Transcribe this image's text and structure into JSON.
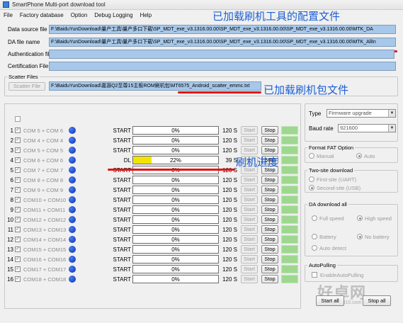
{
  "window": {
    "title": "SmartPhone Multi-port download tool"
  },
  "menu": [
    "File",
    "Factory database",
    "Option",
    "Debug Logging",
    "Help"
  ],
  "annotations": {
    "config_loaded": "已加载刷机工具的配置文件",
    "package_loaded": "已加载刷机包文件",
    "progress": "刷机进度"
  },
  "fields": {
    "data_source_label": "Data source file",
    "data_source_value": "F:\\BaiduYunDownload\\量产工具\\量产多口下载\\SP_MDT_exe_v3.1316.00.00\\SP_MDT_exe_v3.1316.00.00\\SP_MDT_exe_v3.1316.00.00\\MTK_DA",
    "da_file_label": "DA file name",
    "da_file_value": "F:\\BaiduYunDownload\\量产工具\\量产多口下载\\SP_MDT_exe_v3.1316.00.00\\SP_MDT_exe_v3.1316.00.00\\SP_MDT_exe_v3.1316.00.00\\MTK_AllIn",
    "auth_label": "Authentication file",
    "cert_label": "Certification File",
    "scatter_group": "Scatter Files",
    "scatter_button": "Scatter File",
    "scatter_value": "F:\\BaiduYunDownload\\嘉源Q2至尊15主板ROM刷机包\\MT6575_Android_scatter_emmc.txt"
  },
  "ports": [
    {
      "idx": "1",
      "ports": "COM 5 + COM 6",
      "status": "START",
      "percent": 0,
      "pct_text": "0%",
      "time": "120 S",
      "start": "Start",
      "stop": "Stop",
      "checked": "✓"
    },
    {
      "idx": "2",
      "ports": "COM 4 + COM 4",
      "status": "START",
      "percent": 0,
      "pct_text": "0%",
      "time": "120 S",
      "start": "Start",
      "stop": "Stop",
      "checked": "✓"
    },
    {
      "idx": "3",
      "ports": "COM 5 + COM 5",
      "status": "START",
      "percent": 0,
      "pct_text": "0%",
      "time": "120 S",
      "start": "Start",
      "stop": "Stop",
      "checked": "✓"
    },
    {
      "idx": "4",
      "ports": "COM 6 + COM 6",
      "status": "DL",
      "percent": 22,
      "pct_text": "22%",
      "time": "39 S",
      "start": "Start",
      "stop": "Stop",
      "checked": "✓"
    },
    {
      "idx": "5",
      "ports": "COM 7 + COM 7",
      "status": "START",
      "percent": 0,
      "pct_text": "0%",
      "time": "120 S",
      "start": "Start",
      "stop": "Stop",
      "checked": "✓"
    },
    {
      "idx": "6",
      "ports": "COM 8 + COM 8",
      "status": "START",
      "percent": 0,
      "pct_text": "0%",
      "time": "120 S",
      "start": "Start",
      "stop": "Stop",
      "checked": "✓"
    },
    {
      "idx": "7",
      "ports": "COM 9 + COM 9",
      "status": "START",
      "percent": 0,
      "pct_text": "0%",
      "time": "120 S",
      "start": "Start",
      "stop": "Stop",
      "checked": "✓"
    },
    {
      "idx": "8",
      "ports": "COM10 + COM10",
      "status": "START",
      "percent": 0,
      "pct_text": "0%",
      "time": "120 S",
      "start": "Start",
      "stop": "Stop",
      "checked": "✓"
    },
    {
      "idx": "9",
      "ports": "COM11 + COM11",
      "status": "START",
      "percent": 0,
      "pct_text": "0%",
      "time": "120 S",
      "start": "Start",
      "stop": "Stop",
      "checked": "✓"
    },
    {
      "idx": "10",
      "ports": "COM12 + COM12",
      "status": "START",
      "percent": 0,
      "pct_text": "0%",
      "time": "120 S",
      "start": "Start",
      "stop": "Stop",
      "checked": "✓"
    },
    {
      "idx": "11",
      "ports": "COM13 + COM13",
      "status": "START",
      "percent": 0,
      "pct_text": "0%",
      "time": "120 S",
      "start": "Start",
      "stop": "Stop",
      "checked": "✓"
    },
    {
      "idx": "12",
      "ports": "COM14 + COM14",
      "status": "START",
      "percent": 0,
      "pct_text": "0%",
      "time": "120 S",
      "start": "Start",
      "stop": "Stop",
      "checked": "✓"
    },
    {
      "idx": "13",
      "ports": "COM15 + COM15",
      "status": "START",
      "percent": 0,
      "pct_text": "0%",
      "time": "120 S",
      "start": "Start",
      "stop": "Stop",
      "checked": "✓"
    },
    {
      "idx": "14",
      "ports": "COM16 + COM16",
      "status": "START",
      "percent": 0,
      "pct_text": "0%",
      "time": "120 S",
      "start": "Start",
      "stop": "Stop",
      "checked": "✓"
    },
    {
      "idx": "15",
      "ports": "COM17 + COM17",
      "status": "START",
      "percent": 0,
      "pct_text": "0%",
      "time": "120 S",
      "start": "Start",
      "stop": "Stop",
      "checked": "✓"
    },
    {
      "idx": "16",
      "ports": "COM18 + COM18",
      "status": "START",
      "percent": 0,
      "pct_text": "0%",
      "time": "120 S",
      "start": "Start",
      "stop": "Stop",
      "checked": "✓"
    }
  ],
  "right": {
    "type_label": "Type",
    "type_value": "Firmware upgrade",
    "baud_label": "Baud rate",
    "baud_value": "921600",
    "format_fat_title": "Format FAT Option",
    "manual": "Manual",
    "auto": "Auto",
    "two_site_title": "Two-site download",
    "first_site": "First-site (UART)",
    "second_site": "Second-site (USB)",
    "da_title": "DA download all",
    "full_speed": "Full speed",
    "high_speed": "High speed",
    "battery": "Battery",
    "no_battery": "No battery",
    "auto_detect": "Auto detect",
    "autopulling_title": "AutoPulling",
    "enable_autopulling": "EnableAutoPulling",
    "start_all": "Start all",
    "stop_all": "Stop all"
  },
  "watermark": {
    "text": "好卓网",
    "url": "www.3310.com"
  },
  "colors": {
    "field_bg": "#a7c8ea",
    "progress_fill": "#f3e300",
    "status_green": "#9ed88f",
    "annotation_blue": "#1b5fd3",
    "underline_red": "#e31414"
  },
  "icons": [
    "app-icon",
    "status-dot-icon"
  ]
}
